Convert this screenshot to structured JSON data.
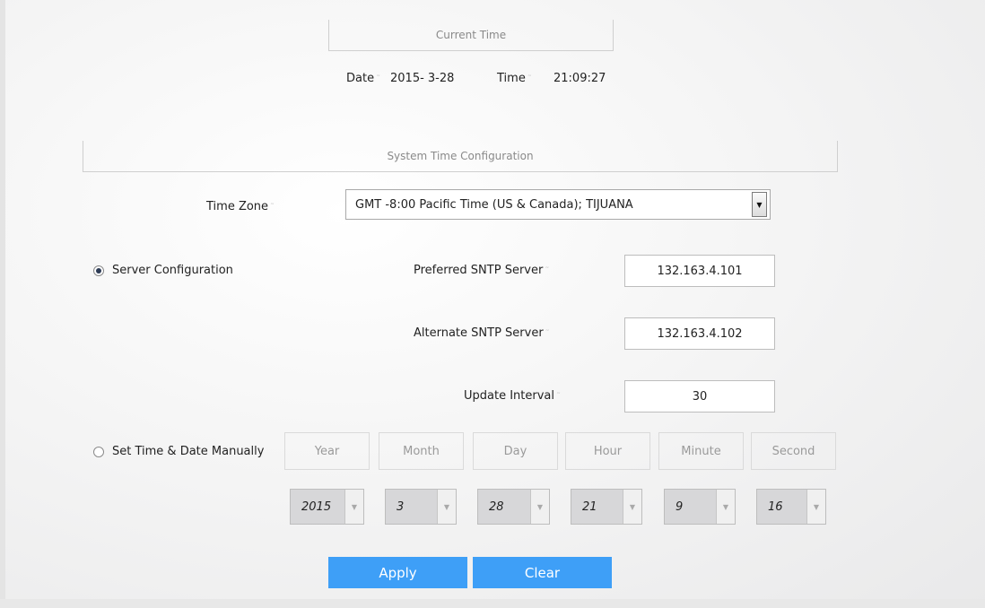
{
  "current_time": {
    "header": "Current Time",
    "date_label": "Date",
    "date_value": "2015- 3-28",
    "time_label": "Time",
    "time_value": "21:09:27"
  },
  "config": {
    "header": "System Time Configuration",
    "time_zone_label": "Time Zone",
    "time_zone_value": "GMT -8:00 Pacific Time (US & Canada); TIJUANA",
    "server_config_label": "Server Configuration",
    "preferred_label": "Preferred SNTP Server",
    "preferred_value": "132.163.4.101",
    "alternate_label": "Alternate SNTP Server",
    "alternate_value": "132.163.4.102",
    "interval_label": "Update Interval",
    "interval_value": "30",
    "manual_label": "Set Time & Date Manually"
  },
  "manual": {
    "columns": [
      "Year",
      "Month",
      "Day",
      "Hour",
      "Minute",
      "Second"
    ],
    "values": [
      "2015",
      "3",
      "28",
      "21",
      "9",
      "16"
    ]
  },
  "buttons": {
    "apply": "Apply",
    "clear": "Clear"
  },
  "icons": {
    "colon": "˜",
    "dropdown": "▼"
  }
}
